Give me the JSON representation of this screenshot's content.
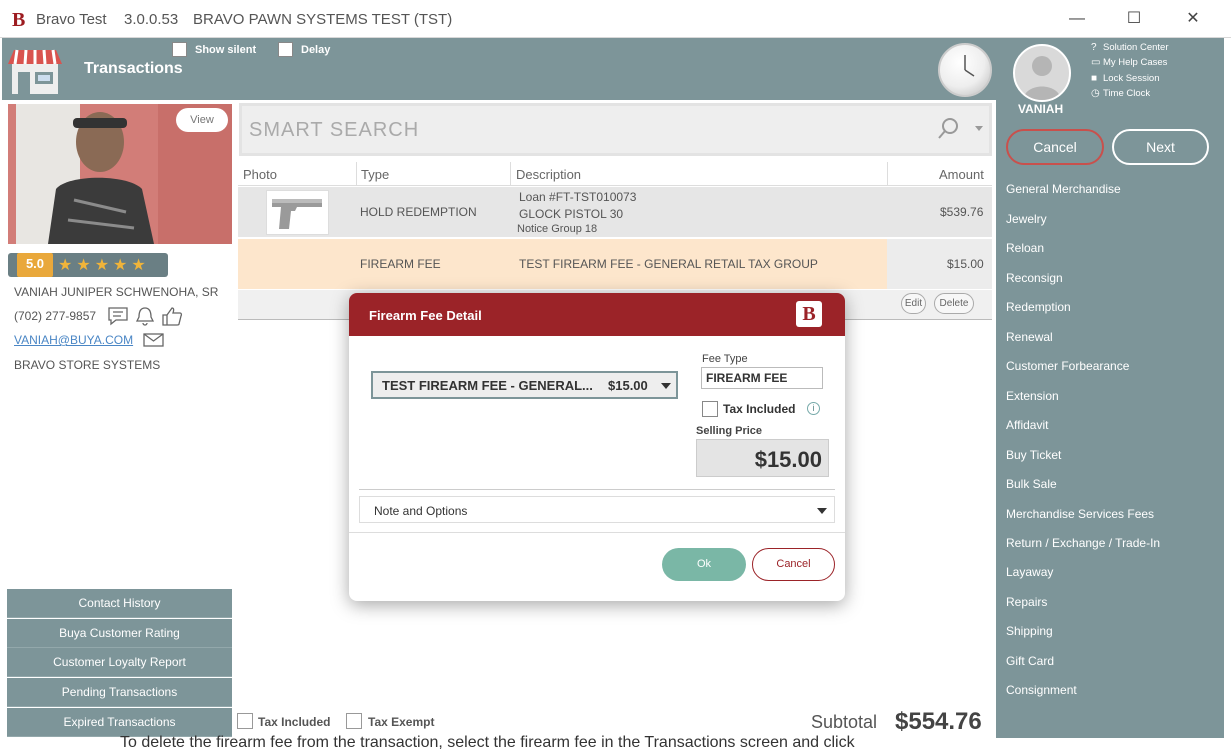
{
  "titlebar": {
    "app_name": "Bravo Test",
    "version": "3.0.0.53",
    "environment": "BRAVO PAWN SYSTEMS TEST (TST)",
    "minimize": "—",
    "maximize": "☐",
    "close": "✕"
  },
  "header": {
    "title": "Transactions",
    "show_silent_label": "Show silent",
    "delay_label": "Delay"
  },
  "user": {
    "name": "VANIAH",
    "links": [
      "Solution Center",
      "My Help Cases",
      "Lock Session",
      "Time Clock"
    ],
    "cancel_label": "Cancel",
    "next_label": "Next"
  },
  "menu": [
    "General Merchandise",
    "Jewelry",
    "Reloan",
    "Reconsign",
    "Redemption",
    "Renewal",
    "Customer Forbearance",
    "Extension",
    "Affidavit",
    "Buy Ticket",
    "Bulk Sale",
    "Merchandise Services Fees",
    "Return / Exchange / Trade-In",
    "Layaway",
    "Repairs",
    "Shipping",
    "Gift Card",
    "Consignment"
  ],
  "customer": {
    "view_label": "View",
    "rating": "5.0",
    "stars": "★★★★★",
    "name": "VANIAH JUNIPER SCHWENOHA, SR",
    "phone": "(702) 277-9857",
    "email": "VANIAH@BUYA.COM",
    "company": "BRAVO STORE SYSTEMS",
    "buttons": [
      "Contact History",
      "Buya Customer Rating",
      "Customer Loyalty Report",
      "Pending Transactions",
      "Expired Transactions"
    ]
  },
  "search": {
    "placeholder": "SMART SEARCH"
  },
  "grid": {
    "headers": {
      "photo": "Photo",
      "type": "Type",
      "description": "Description",
      "amount": "Amount"
    },
    "rows": [
      {
        "type": "HOLD REDEMPTION",
        "desc1": "Loan #FT-TST010073",
        "desc2": "GLOCK PISTOL 30",
        "desc3": "Notice Group 18",
        "amount": "$539.76"
      },
      {
        "type": "FIREARM FEE",
        "desc1": "TEST FIREARM FEE - GENERAL RETAIL TAX GROUP",
        "amount": "$15.00"
      }
    ],
    "edit_label": "Edit",
    "delete_label": "Delete"
  },
  "footer": {
    "tax_included_label": "Tax Included",
    "tax_exempt_label": "Tax Exempt",
    "subtotal_label": "Subtotal",
    "subtotal_value": "$554.76",
    "under_text": "To delete the firearm fee from the transaction, select the firearm fee in the Transactions screen and click"
  },
  "modal": {
    "title": "Firearm Fee Detail",
    "logo": "B",
    "fee_select_name": "TEST FIREARM FEE - GENERAL...",
    "fee_select_amount": "$15.00",
    "fee_type_label": "Fee Type",
    "fee_type_value": "FIREARM FEE",
    "tax_included_label": "Tax Included",
    "selling_price_label": "Selling Price",
    "selling_price": "$15.00",
    "notes_label": "Note and Options",
    "ok_label": "Ok",
    "cancel_label": "Cancel"
  },
  "colors": {
    "header_bg": "#7d9599",
    "brand_red": "#9b2328",
    "ok_green": "#7ab7a6",
    "rating_orange": "#e9a83b"
  }
}
